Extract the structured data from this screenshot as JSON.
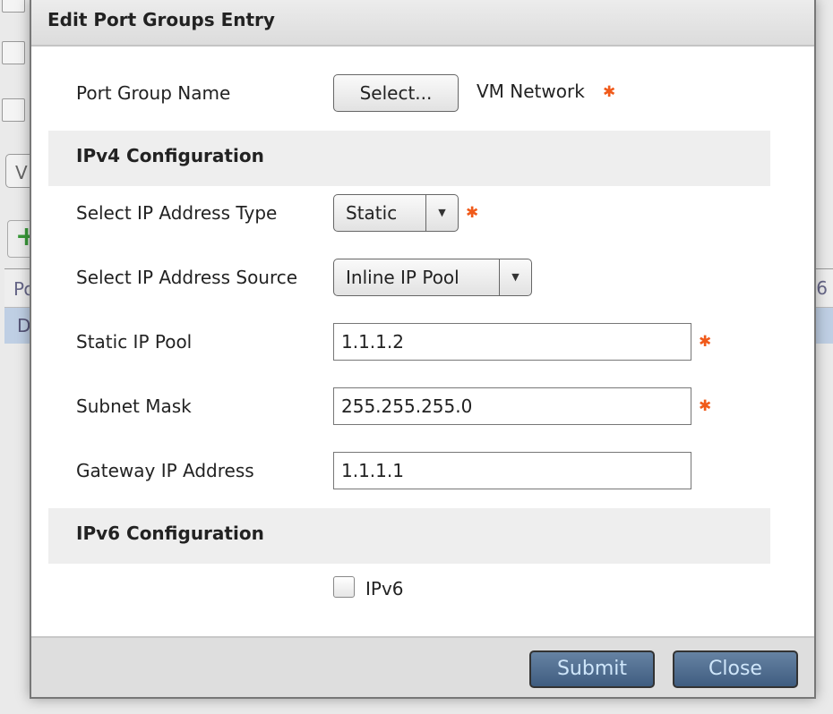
{
  "background": {
    "button_fragment": "V",
    "header_fragment": "Po",
    "header_fragment_right": "6",
    "row_fragment": "D",
    "add_icon": "plus-icon"
  },
  "dialog": {
    "title": "Edit Port Groups Entry",
    "port_group_name": {
      "label": "Port Group Name",
      "button": "Select...",
      "value": "VM Network"
    },
    "ipv4_section": "IPv4 Configuration",
    "ip_address_type": {
      "label": "Select IP Address Type",
      "value": "Static"
    },
    "ip_address_source": {
      "label": "Select IP Address Source",
      "value": "Inline IP Pool"
    },
    "static_ip_pool": {
      "label": "Static IP Pool",
      "value": "1.1.1.2"
    },
    "subnet_mask": {
      "label": "Subnet Mask",
      "value": "255.255.255.0"
    },
    "gateway": {
      "label": "Gateway IP Address",
      "value": "1.1.1.1"
    },
    "ipv6_section": "IPv6 Configuration",
    "ipv6_checkbox": {
      "label": "IPv6",
      "checked": false
    },
    "required_marker": "✱",
    "submit": "Submit",
    "close": "Close"
  },
  "colors": {
    "required": "#f05a1a",
    "primary_button": "#4f6d90",
    "selected_row": "#bfcfe4"
  }
}
